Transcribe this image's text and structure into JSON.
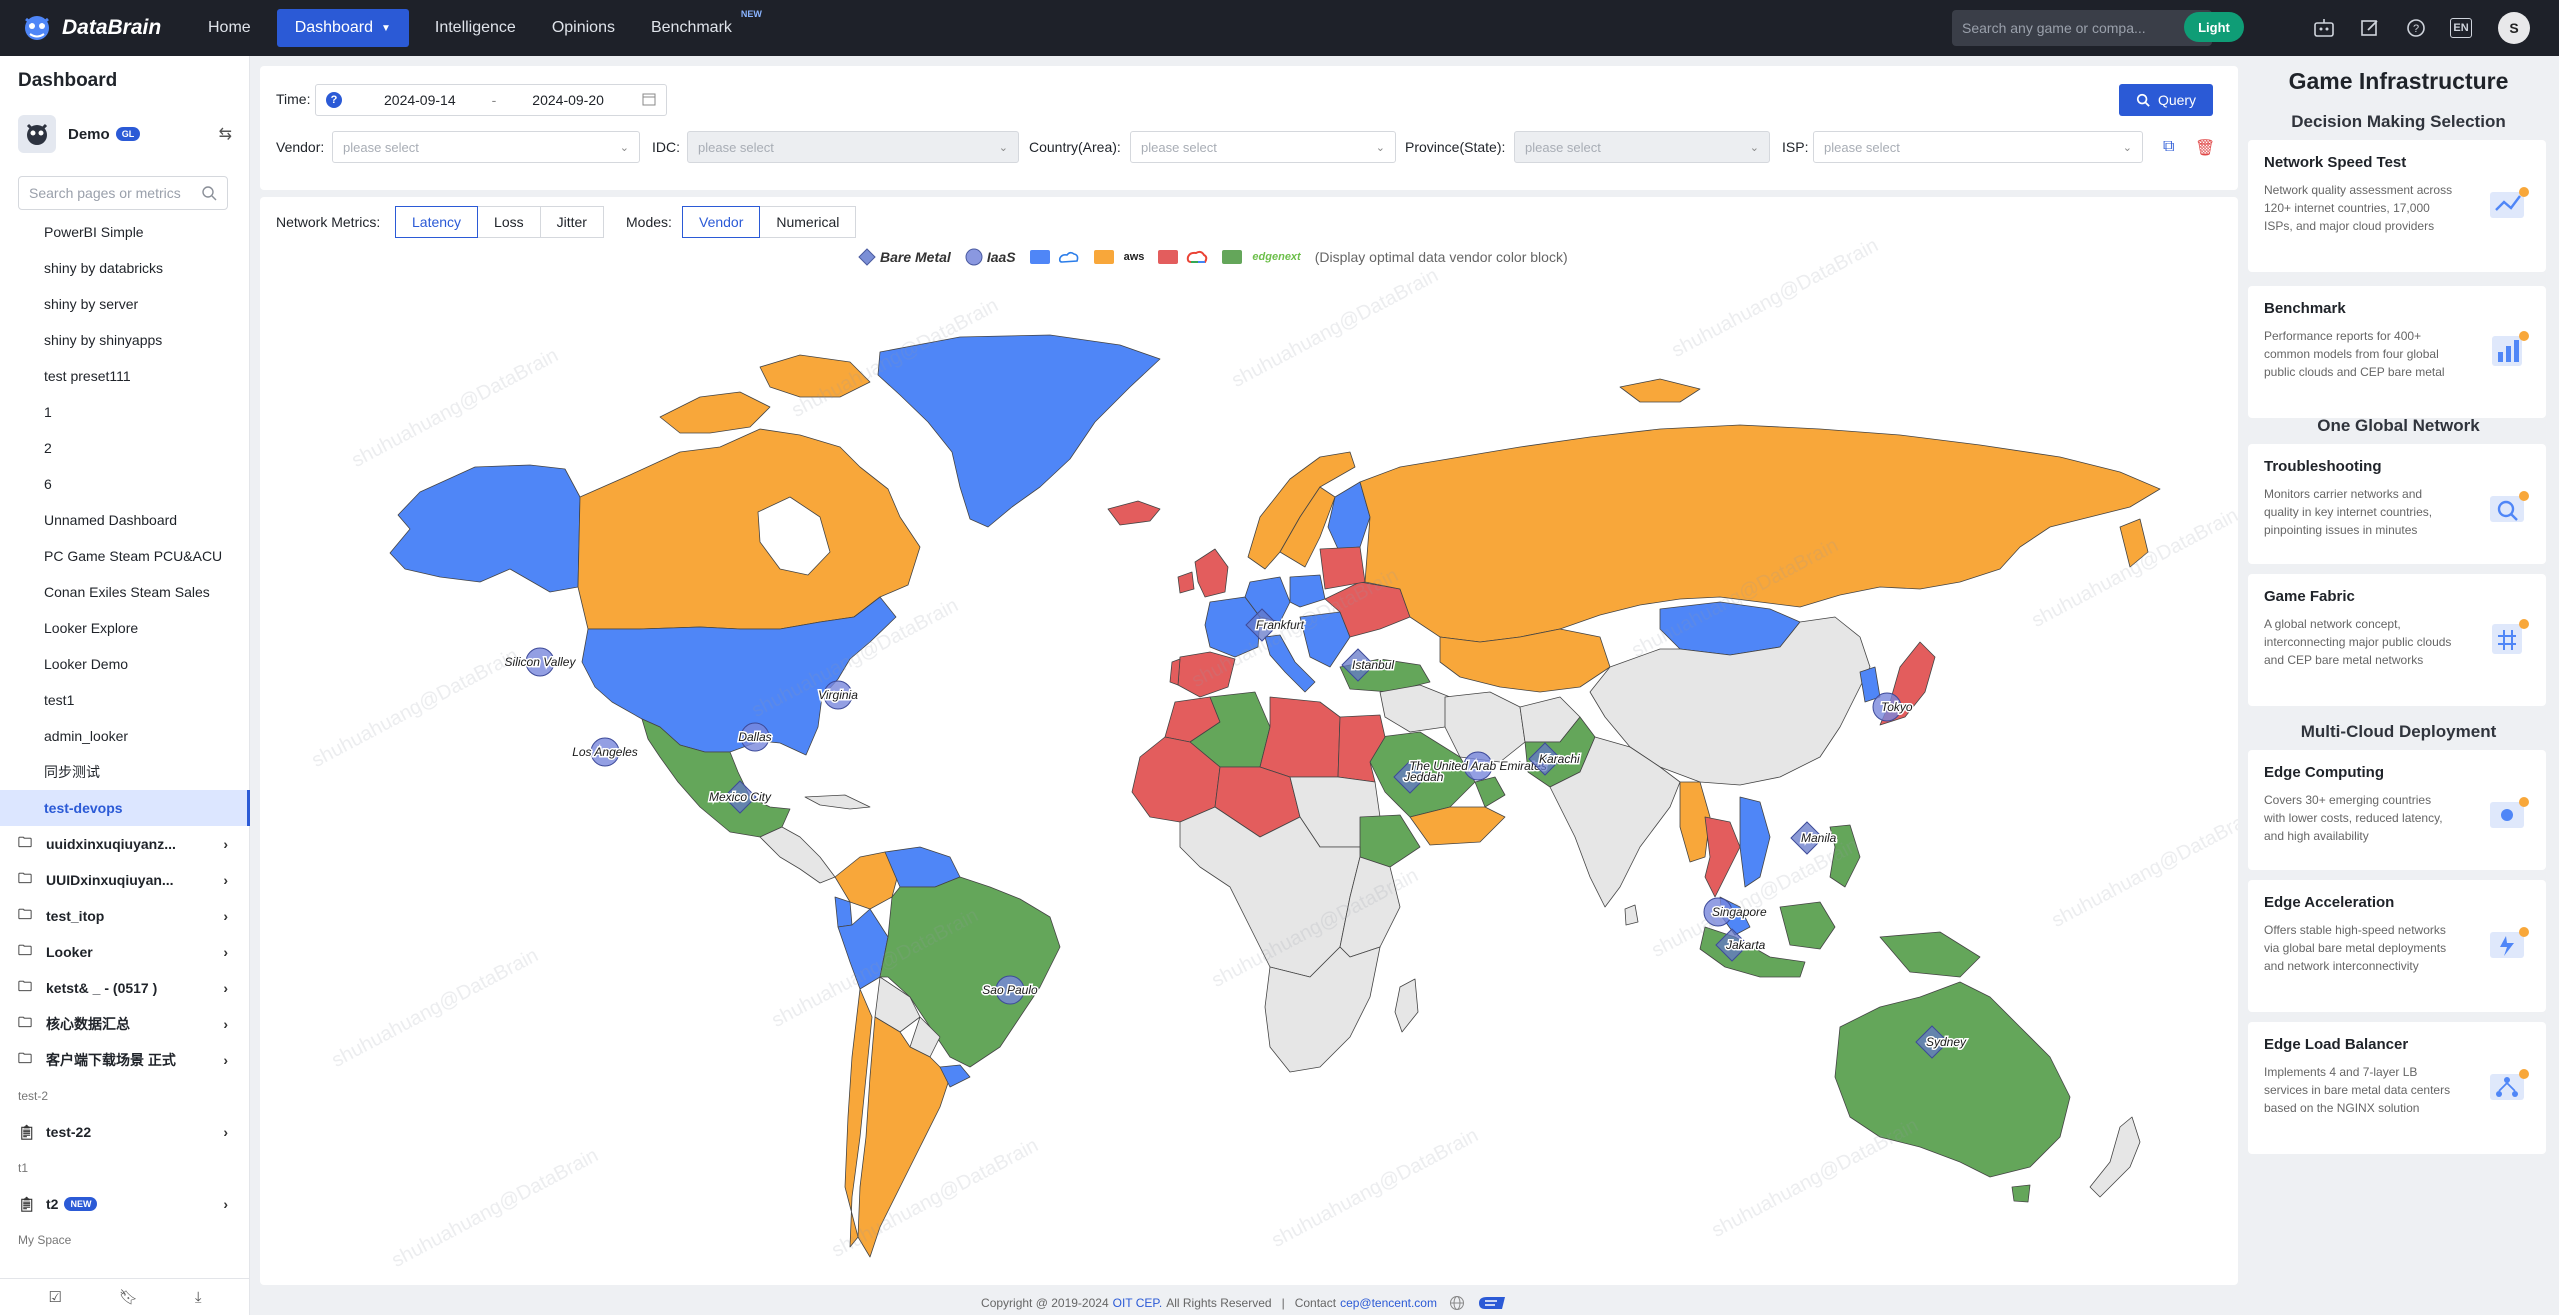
{
  "brand": {
    "name": "DataBrain"
  },
  "nav": {
    "items": [
      {
        "label": "Home"
      },
      {
        "label": "Dashboard"
      },
      {
        "label": "Intelligence"
      },
      {
        "label": "Opinions"
      },
      {
        "label": "Benchmark",
        "badge": "NEW"
      }
    ],
    "search_placeholder": "Search any game or compa...",
    "theme_label": "Light",
    "lang_label": "EN",
    "avatar_letter": "S"
  },
  "sidebar": {
    "title": "Dashboard",
    "user": {
      "name": "Demo",
      "badge": "GL"
    },
    "search_placeholder": "Search pages or metrics",
    "items": [
      {
        "label": "PowerBI Simple"
      },
      {
        "label": "shiny by databricks"
      },
      {
        "label": "shiny by server"
      },
      {
        "label": "shiny by shinyapps"
      },
      {
        "label": "test preset111"
      },
      {
        "label": "1"
      },
      {
        "label": "2"
      },
      {
        "label": "6"
      },
      {
        "label": "Unnamed Dashboard"
      },
      {
        "label": "PC Game Steam PCU&ACU"
      },
      {
        "label": "Conan Exiles Steam Sales"
      },
      {
        "label": "Looker Explore"
      },
      {
        "label": "Looker Demo"
      },
      {
        "label": "test1"
      },
      {
        "label": "admin_looker"
      },
      {
        "label": "同步测试"
      },
      {
        "label": "test-devops"
      }
    ],
    "folders": [
      {
        "label": "uuidxinxuqiuyanz..."
      },
      {
        "label": "UUIDxinxuqiuyan..."
      },
      {
        "label": "test_itop"
      },
      {
        "label": "Looker"
      },
      {
        "label": "ketst& _ - (0517 )"
      },
      {
        "label": "核心数据汇总"
      },
      {
        "label": "客户端下载场景 正式"
      }
    ],
    "section_test2": "test-2",
    "folder_test22": "test-22",
    "section_t1": "t1",
    "folder_t2": "t2",
    "folder_t2_badge": "NEW",
    "section_myspace": "My Space"
  },
  "filters": {
    "time_label": "Time:",
    "date_start": "2024-09-14",
    "date_sep": "-",
    "date_end": "2024-09-20",
    "query_label": "Query",
    "vendor_label": "Vendor:",
    "idc_label": "IDC:",
    "country_label": "Country(Area):",
    "province_label": "Province(State):",
    "isp_label": "ISP:",
    "placeholder": "please select"
  },
  "metrics": {
    "label": "Network Metrics:",
    "options": [
      "Latency",
      "Loss",
      "Jitter"
    ],
    "selected": "Latency",
    "modes_label": "Modes:",
    "modes": [
      "Vendor",
      "Numerical"
    ],
    "mode_selected": "Vendor"
  },
  "legend": {
    "bare_metal": "Bare Metal",
    "iaas": "IaaS",
    "vendors": [
      {
        "color": "#4f86f7",
        "logo": "tencent-cloud-icon"
      },
      {
        "color": "#f8a73a",
        "logo": "aws"
      },
      {
        "color": "#e35d5d",
        "logo": "google-cloud-icon"
      },
      {
        "color": "#64a65a",
        "logo": "edgenext"
      }
    ],
    "note": "(Display optimal data vendor color block)"
  },
  "map": {
    "cities": [
      {
        "name": "Silicon Valley",
        "type": "iaas"
      },
      {
        "name": "Los Angeles",
        "type": "iaas"
      },
      {
        "name": "Dallas",
        "type": "iaas"
      },
      {
        "name": "Virginia",
        "type": "iaas"
      },
      {
        "name": "Mexico City",
        "type": "bare"
      },
      {
        "name": "Sao Paulo",
        "type": "iaas"
      },
      {
        "name": "Frankfurt",
        "type": "bare"
      },
      {
        "name": "Istanbul",
        "type": "bare"
      },
      {
        "name": "Jeddah",
        "type": "bare"
      },
      {
        "name": "The United Arab Emirates",
        "type": "iaas"
      },
      {
        "name": "Karachi",
        "type": "bare"
      },
      {
        "name": "Tokyo",
        "type": "iaas"
      },
      {
        "name": "Manila",
        "type": "bare"
      },
      {
        "name": "Singapore",
        "type": "iaas"
      },
      {
        "name": "Jakarta",
        "type": "bare"
      },
      {
        "name": "Sydney",
        "type": "bare"
      }
    ],
    "colors": {
      "blue": "#4f86f7",
      "orange": "#f8a73a",
      "red": "#e35d5d",
      "green": "#64a65a",
      "grey": "#e6e6e6"
    }
  },
  "watermark": "shuhuahuang@DataBrain",
  "footer": {
    "copyright": "Copyright @ 2019-2024",
    "company": "OIT CEP.",
    "rights": "All Rights Reserved",
    "sep": "|",
    "contact_label": "Contact",
    "email": "cep@tencent.com"
  },
  "right": {
    "title": "Game Infrastructure",
    "sections": [
      "Decision Making Selection",
      "One Global Network",
      "Multi-Cloud Deployment"
    ],
    "cards": [
      {
        "title": "Network Speed Test",
        "desc": "Network quality assessment across 120+ internet countries, 17,000 ISPs, and major cloud providers"
      },
      {
        "title": "Benchmark",
        "desc": "Performance reports for 400+ common models from four global public clouds and CEP bare metal"
      },
      {
        "title": "Troubleshooting",
        "desc": "Monitors carrier networks and quality in key internet countries, pinpointing issues in minutes"
      },
      {
        "title": "Game Fabric",
        "desc": "A global network concept, interconnecting major public clouds and CEP bare metal networks"
      },
      {
        "title": "Edge Computing",
        "desc": "Covers 30+ emerging countries with lower costs, reduced latency, and high availability"
      },
      {
        "title": "Edge Acceleration",
        "desc": "Offers stable high-speed networks via global bare metal deployments and network interconnectivity"
      },
      {
        "title": "Edge Load Balancer",
        "desc": "Implements 4 and 7-layer LB services in bare metal data centers based on the NGINX solution"
      }
    ]
  }
}
